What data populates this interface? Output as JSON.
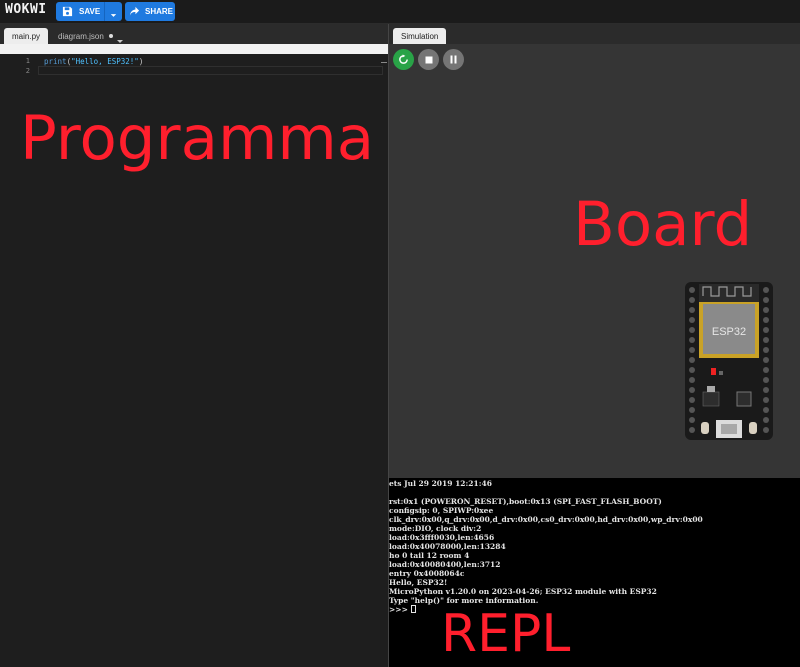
{
  "app": {
    "logo": "WOKWI"
  },
  "toolbar": {
    "save_label": "SAVE",
    "share_label": "SHARE"
  },
  "editor": {
    "tabs": [
      {
        "label": "main.py",
        "active": true
      },
      {
        "label": "diagram.json",
        "modified": true
      }
    ],
    "lines": [
      {
        "number": "1",
        "code": "print(\"Hello, ESP32!\")"
      },
      {
        "number": "2",
        "code": ""
      }
    ]
  },
  "simulation": {
    "tab_label": "Simulation",
    "controls": [
      "restart-icon",
      "stop-icon",
      "pause-icon"
    ],
    "board_label": "ESP32"
  },
  "repl": {
    "lines": [
      "ets Jul 29 2019 12:21:46",
      "",
      "rst:0x1 (POWERON_RESET),boot:0x13 (SPI_FAST_FLASH_BOOT)",
      "configsip: 0, SPIWP:0xee",
      "clk_drv:0x00,q_drv:0x00,d_drv:0x00,cs0_drv:0x00,hd_drv:0x00,wp_drv:0x00",
      "mode:DIO, clock div:2",
      "load:0x3fff0030,len:4656",
      "load:0x40078000,len:13284",
      "ho 0 tail 12 room 4",
      "load:0x40080400,len:3712",
      "entry 0x4008064c",
      "Hello, ESP32!",
      "MicroPython v1.20.0 on 2023-04-26; ESP32 module with ESP32",
      "Type \"help()\" for more information."
    ],
    "prompt": ">>> "
  },
  "annotations": {
    "program": "Programma",
    "board": "Board",
    "repl": "REPL"
  },
  "colors": {
    "accent": "#1f7ae0",
    "run": "#29a347",
    "annotation": "#ff1f2d"
  }
}
